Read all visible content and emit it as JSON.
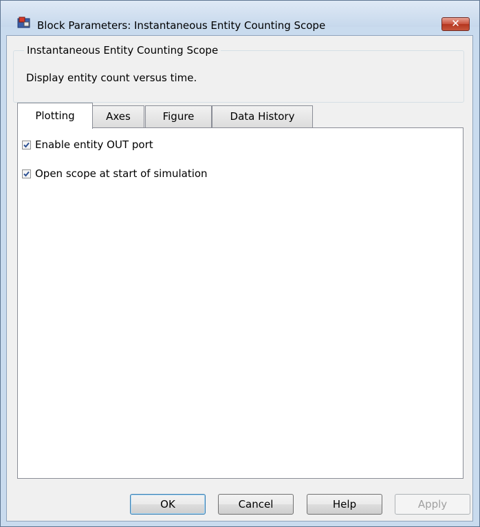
{
  "window": {
    "title": "Block Parameters: Instantaneous Entity Counting Scope",
    "close_label": "✕",
    "icon": "simulink-block-icon"
  },
  "block": {
    "group_title": "Instantaneous Entity Counting Scope",
    "description": "Display entity count versus time."
  },
  "tabs": [
    {
      "label": "Plotting",
      "active": true
    },
    {
      "label": "Axes",
      "active": false
    },
    {
      "label": "Figure",
      "active": false
    },
    {
      "label": "Data History",
      "active": false
    }
  ],
  "plotting": {
    "options": [
      {
        "label": "Enable entity OUT port",
        "checked": true
      },
      {
        "label": "Open scope at start of simulation",
        "checked": true
      }
    ]
  },
  "buttons": {
    "ok": "OK",
    "cancel": "Cancel",
    "help": "Help",
    "apply": "Apply"
  },
  "colors": {
    "frame": "#c9dbee",
    "close_button": "#c7563c",
    "check_mark": "#2b4f92"
  }
}
